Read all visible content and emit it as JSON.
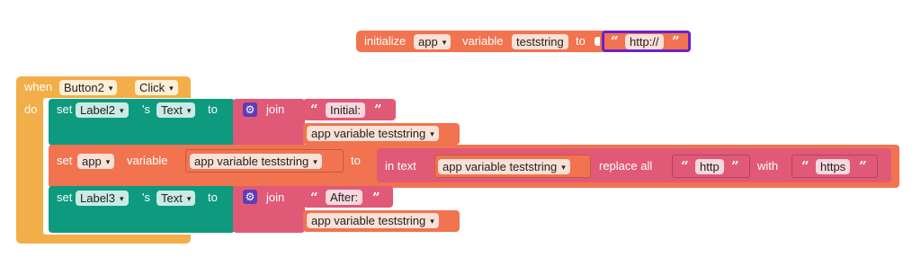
{
  "colors": {
    "variables": "#f1734f",
    "variables_dark": "#c45a3b",
    "event": "#f2ae48",
    "components": "#0d9a7f",
    "text": "#e05a78",
    "selected_outline": "#6a22c9"
  },
  "global_init": {
    "initialize": "initialize",
    "scope": "app",
    "variable": "variable",
    "name": "teststring",
    "to": "to",
    "value": "http://"
  },
  "event": {
    "when": "when",
    "component": "Button2",
    "event_name": "Click",
    "do": "do"
  },
  "stmt1": {
    "set": "set",
    "component": "Label2",
    "possessive": "'s",
    "property": "Text",
    "to": "to",
    "join": "join",
    "text1": "Initial:",
    "getter": "app variable teststring"
  },
  "stmt2": {
    "set": "set",
    "scope": "app",
    "variable": "variable",
    "getter_target": "app variable teststring",
    "to": "to",
    "in_text": "in text",
    "getter_source": "app variable teststring",
    "replace_all": "replace all",
    "segment": "http",
    "with": "with",
    "replacement": "https"
  },
  "stmt3": {
    "set": "set",
    "component": "Label3",
    "possessive": "'s",
    "property": "Text",
    "to": "to",
    "join": "join",
    "text1": "After:",
    "getter": "app variable teststring"
  },
  "icons": {
    "quote_open": "“",
    "quote_close": "”",
    "gear": "gear-icon"
  }
}
